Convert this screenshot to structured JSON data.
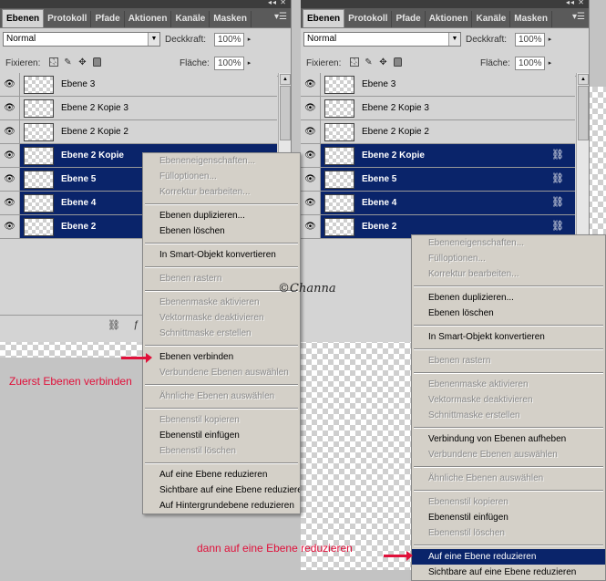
{
  "tabs": [
    "Ebenen",
    "Protokoll",
    "Pfade",
    "Aktionen",
    "Kanäle",
    "Masken"
  ],
  "blend_mode": "Normal",
  "opacity_label": "Deckkraft:",
  "opacity_value": "100%",
  "lock_label": "Fixieren:",
  "fill_label": "Fläche:",
  "fill_value": "100%",
  "panel_menu_icon": "panel-menu-icon",
  "layers": [
    {
      "name": "Ebene 3",
      "selected": false
    },
    {
      "name": "Ebene 2 Kopie 3",
      "selected": false
    },
    {
      "name": "Ebene 2 Kopie 2",
      "selected": false
    },
    {
      "name": "Ebene 2 Kopie",
      "selected": true
    },
    {
      "name": "Ebene 5",
      "selected": true
    },
    {
      "name": "Ebene 4",
      "selected": true
    },
    {
      "name": "Ebene 2",
      "selected": true
    }
  ],
  "menu_left": [
    {
      "label": "Ebeneneigenschaften...",
      "disabled": true
    },
    {
      "label": "Fülloptionen...",
      "disabled": true
    },
    {
      "label": "Korrektur bearbeiten...",
      "disabled": true
    },
    {
      "sep": true
    },
    {
      "label": "Ebenen duplizieren...",
      "disabled": false
    },
    {
      "label": "Ebenen löschen",
      "disabled": false
    },
    {
      "sep": true
    },
    {
      "label": "In Smart-Objekt konvertieren",
      "disabled": false
    },
    {
      "sep": true
    },
    {
      "label": "Ebenen rastern",
      "disabled": true
    },
    {
      "sep": true
    },
    {
      "label": "Ebenenmaske aktivieren",
      "disabled": true
    },
    {
      "label": "Vektormaske deaktivieren",
      "disabled": true
    },
    {
      "label": "Schnittmaske erstellen",
      "disabled": true
    },
    {
      "sep": true
    },
    {
      "label": "Ebenen verbinden",
      "disabled": false
    },
    {
      "label": "Verbundene Ebenen auswählen",
      "disabled": true
    },
    {
      "sep": true
    },
    {
      "label": "Ähnliche Ebenen auswählen",
      "disabled": true
    },
    {
      "sep": true
    },
    {
      "label": "Ebenenstil kopieren",
      "disabled": true
    },
    {
      "label": "Ebenenstil einfügen",
      "disabled": false
    },
    {
      "label": "Ebenenstil löschen",
      "disabled": true
    },
    {
      "sep": true
    },
    {
      "label": "Auf eine Ebene reduzieren",
      "disabled": false
    },
    {
      "label": "Sichtbare auf eine Ebene reduzieren",
      "disabled": false
    },
    {
      "label": "Auf Hintergrundebene reduzieren",
      "disabled": false
    }
  ],
  "menu_right": [
    {
      "label": "Ebeneneigenschaften...",
      "disabled": true
    },
    {
      "label": "Fülloptionen...",
      "disabled": true
    },
    {
      "label": "Korrektur bearbeiten...",
      "disabled": true
    },
    {
      "sep": true
    },
    {
      "label": "Ebenen duplizieren...",
      "disabled": false
    },
    {
      "label": "Ebenen löschen",
      "disabled": false
    },
    {
      "sep": true
    },
    {
      "label": "In Smart-Objekt konvertieren",
      "disabled": false
    },
    {
      "sep": true
    },
    {
      "label": "Ebenen rastern",
      "disabled": true
    },
    {
      "sep": true
    },
    {
      "label": "Ebenenmaske aktivieren",
      "disabled": true
    },
    {
      "label": "Vektormaske deaktivieren",
      "disabled": true
    },
    {
      "label": "Schnittmaske erstellen",
      "disabled": true
    },
    {
      "sep": true
    },
    {
      "label": "Verbindung von Ebenen aufheben",
      "disabled": false
    },
    {
      "label": "Verbundene Ebenen auswählen",
      "disabled": true
    },
    {
      "sep": true
    },
    {
      "label": "Ähnliche Ebenen auswählen",
      "disabled": true
    },
    {
      "sep": true
    },
    {
      "label": "Ebenenstil kopieren",
      "disabled": true
    },
    {
      "label": "Ebenenstil einfügen",
      "disabled": false
    },
    {
      "label": "Ebenenstil löschen",
      "disabled": true
    },
    {
      "sep": true
    },
    {
      "label": "Auf eine Ebene reduzieren",
      "disabled": false,
      "highlighted": true
    },
    {
      "label": "Sichtbare auf eine Ebene reduzieren",
      "disabled": false
    }
  ],
  "annotation_1": "Zuerst Ebenen verbinden",
  "annotation_2": "dann auf eine Ebene reduzieren",
  "watermark": "©Channa",
  "colors": {
    "selection": "#0a246a",
    "annotation": "#e0103a"
  }
}
